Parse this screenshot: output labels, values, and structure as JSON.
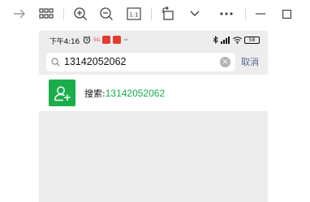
{
  "status_bar": {
    "time": "下午4:16",
    "network_badge": "5G",
    "overflow": "···",
    "battery": "58"
  },
  "search": {
    "value": "13142052062",
    "clear_glyph": "×",
    "cancel_label": "取消"
  },
  "result": {
    "prefix": "搜索:",
    "number": "13142052062"
  },
  "colors": {
    "accent_green": "#1aad4a",
    "cancel_blue": "#576b95",
    "background": "#ececec"
  },
  "toolbar": {
    "icons": [
      "arrow-right-icon",
      "grid-icon",
      "zoom-in-icon",
      "zoom-out-icon",
      "actual-size-icon",
      "rotate-icon",
      "chevron-down-icon",
      "more-icon",
      "minimize-icon",
      "maximize-icon"
    ],
    "actual_size_label": "1:1"
  }
}
